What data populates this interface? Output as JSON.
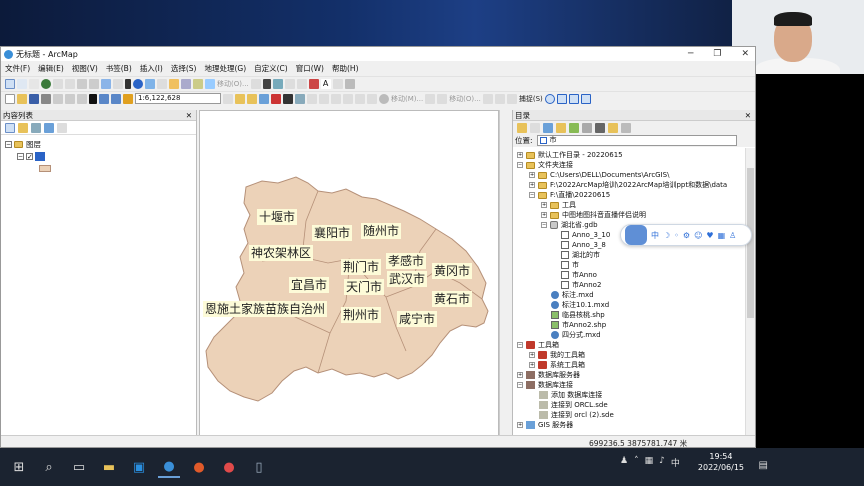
{
  "window": {
    "title": "无标题 - ArcMap",
    "controls": [
      "─",
      "❐",
      "✕"
    ]
  },
  "menubar": [
    "文件(F)",
    "编辑(E)",
    "视图(V)",
    "书签(B)",
    "插入(I)",
    "选择(S)",
    "地理处理(G)",
    "自定义(C)",
    "窗口(W)",
    "帮助(H)"
  ],
  "toolbar": {
    "scale": "1:6,122,628",
    "move_label": "移动(O)...",
    "move_label2": "移动(M)...",
    "capture_label": "捕捉(S)"
  },
  "toc": {
    "title": "内容列表",
    "layers_label": "图层"
  },
  "map": {
    "cities": [
      "十堰市",
      "襄阳市",
      "随州市",
      "神农架林区",
      "孝感市",
      "荆门市",
      "黄冈市",
      "宜昌市",
      "武汉市",
      "天门市",
      "黄石市",
      "恩施土家族苗族自治州",
      "荆州市",
      "咸宁市"
    ]
  },
  "catalog": {
    "title": "目录",
    "location_label": "位置:",
    "location_value": "市",
    "items": [
      "默认工作目录 - 20220615",
      "文件夹连接",
      "C:\\Users\\DELL\\Documents\\ArcGIS\\",
      "F:\\2022ArcMap培训\\2022ArcMap培训ppt和数据\\data",
      "F:\\直播\\20220615",
      "工具",
      "中图地图抖音直播伴侣说明",
      "湖北省.gdb",
      "Anno_3_10",
      "Anno_3_8",
      "湖北的市",
      "市",
      "市Anno",
      "市Anno2",
      "标注.mxd",
      "标注10.1.mxd",
      "临县核桃.shp",
      "市Anno2.shp",
      "四分式.mxd",
      "工具箱",
      "我的工具箱",
      "系统工具箱",
      "数据库服务器",
      "数据库连接",
      "添加 数据库连接",
      "连接到 ORCL.sde",
      "连接到 orcl (2).sde",
      "GIS 服务器"
    ]
  },
  "floatbar": {
    "items": [
      "中",
      "☽",
      "◦",
      "⚙",
      "☺",
      "♥",
      "▦",
      "♙"
    ]
  },
  "status": {
    "coords": "699236.5  3875781.747 米"
  },
  "taskbar": {
    "time": "19:54",
    "date": "2022/06/15"
  },
  "colors": {
    "province_fill": "#ecd2b8",
    "province_stroke": "#b59078",
    "label_bg": "#fdfbd8",
    "accent": "#2e6fd8"
  }
}
